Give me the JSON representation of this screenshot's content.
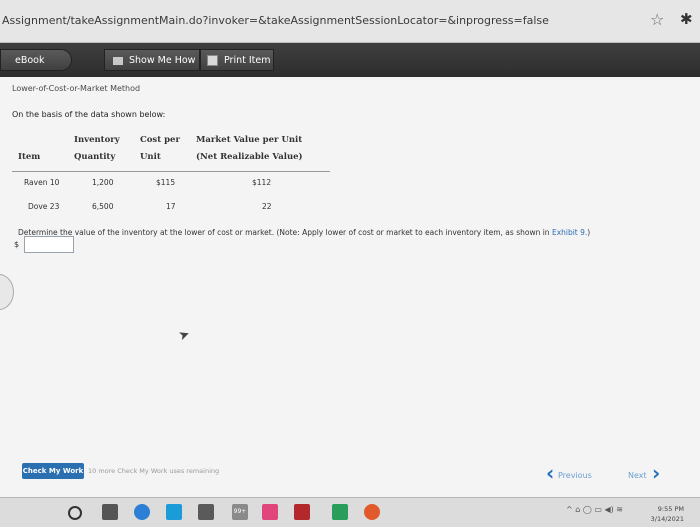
{
  "browser": {
    "url": "Assignment/takeAssignmentMain.do?invoker=&takeAssignmentSessionLocator=&inprogress=false"
  },
  "toolbar": {
    "ebook": "eBook",
    "show_me_how": "Show Me How",
    "print_item": "Print Item"
  },
  "problem": {
    "title": "Lower-of-Cost-or-Market Method",
    "intro": "On the basis of the data shown below:",
    "headers": {
      "item": "Item",
      "inventory_l1": "Inventory",
      "inventory_l2": "Quantity",
      "cost_l1": "Cost per",
      "cost_l2": "Unit",
      "market_l1": "Market Value per Unit",
      "market_l2": "(Net Realizable Value)"
    },
    "rows": [
      {
        "item": "Raven 10",
        "quantity": "1,200",
        "cost": "$115",
        "market": "$112"
      },
      {
        "item": "Dove 23",
        "quantity": "6,500",
        "cost": "17",
        "market": "22"
      }
    ],
    "question": "Determine the value of the inventory at the lower of cost or market. (Note: Apply lower of cost or market to each inventory item, as shown in ",
    "question_link": "Exhibit 9.",
    "question_end": ")",
    "answer_prefix": "$",
    "answer_value": ""
  },
  "footer": {
    "check_work": "Check My Work",
    "remaining": "10 more Check My Work uses remaining",
    "previous": "Previous",
    "next": "Next"
  },
  "taskbar": {
    "time": "9:55 PM",
    "date": "3/14/2021",
    "badge": "99+"
  }
}
